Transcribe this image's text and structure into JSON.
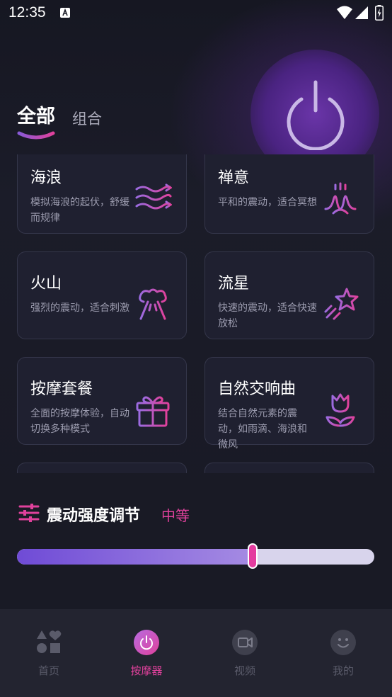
{
  "status_bar": {
    "time": "12:35"
  },
  "tabs": [
    {
      "label": "全部",
      "active": true
    },
    {
      "label": "组合",
      "active": false
    }
  ],
  "modes": [
    {
      "title": "海浪",
      "desc": "模拟海浪的起伏，舒缓而规律",
      "icon": "waves-icon"
    },
    {
      "title": "禅意",
      "desc": "平和的震动，适合冥想",
      "icon": "lotus-icon"
    },
    {
      "title": "火山",
      "desc": "强烈的震动，适合刺激",
      "icon": "volcano-icon"
    },
    {
      "title": "流星",
      "desc": "快速的震动，适合快速放松",
      "icon": "shooting-star-icon"
    },
    {
      "title": "按摩套餐",
      "desc": "全面的按摩体验，自动切换多种模式",
      "icon": "gift-icon"
    },
    {
      "title": "自然交响曲",
      "desc": "结合自然元素的震动，如雨滴、海浪和微风",
      "icon": "tulip-icon"
    }
  ],
  "intensity": {
    "title": "震动强度调节",
    "level_label": "中等",
    "value": 0.66
  },
  "nav": [
    {
      "label": "首页",
      "icon": "shapes-icon",
      "active": false
    },
    {
      "label": "按摩器",
      "icon": "power-icon",
      "active": true
    },
    {
      "label": "视频",
      "icon": "video-icon",
      "active": false
    },
    {
      "label": "我的",
      "icon": "smiley-icon",
      "active": false
    }
  ],
  "colors": {
    "accent": "#e0419c",
    "primary": "#6f4bd6",
    "background": "#191a25"
  }
}
